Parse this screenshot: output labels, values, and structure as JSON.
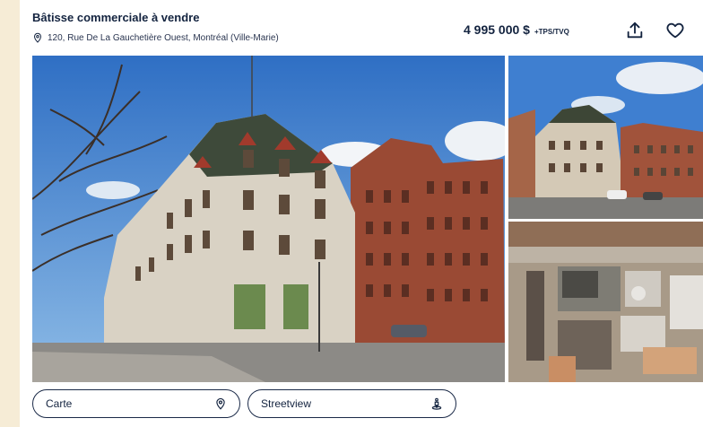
{
  "listing": {
    "title": "Bâtisse commerciale à vendre",
    "address": "120, Rue De La Gauchetière Ouest, Montréal (Ville-Marie)",
    "price": "4 995 000 $",
    "tax_note": "+TPS/TVQ"
  },
  "actions": {
    "share_icon": "share-upload-icon",
    "favorite_icon": "heart-outline-icon"
  },
  "photos": [
    {
      "label": "main-building-street-view"
    },
    {
      "label": "building-aerial-angle"
    },
    {
      "label": "rooftop-aerial-view"
    }
  ],
  "buttons": {
    "map_label": "Carte",
    "streetview_label": "Streetview"
  },
  "colors": {
    "navy": "#13233f",
    "page_background": "#f6ecd6"
  }
}
